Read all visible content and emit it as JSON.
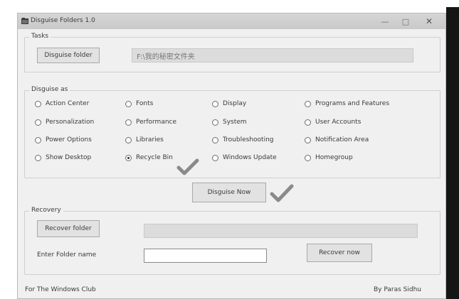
{
  "window": {
    "title": "Disguise Folders 1.0",
    "minimize": "—",
    "maximize": "□",
    "close": "✕"
  },
  "tasks": {
    "legend": "Tasks",
    "disguise_button": "Disguise folder",
    "path": "F:\\我的秘密文件夹"
  },
  "disguise_as": {
    "legend": "Disguise as",
    "options": [
      {
        "label": "Action Center",
        "checked": false
      },
      {
        "label": "Fonts",
        "checked": false
      },
      {
        "label": "Display",
        "checked": false
      },
      {
        "label": "Programs and Features",
        "checked": false
      },
      {
        "label": "Personalization",
        "checked": false
      },
      {
        "label": "Performance",
        "checked": false
      },
      {
        "label": "System",
        "checked": false
      },
      {
        "label": "User Accounts",
        "checked": false
      },
      {
        "label": "Power Options",
        "checked": false
      },
      {
        "label": "Libraries",
        "checked": false
      },
      {
        "label": "Troubleshooting",
        "checked": false
      },
      {
        "label": "Notification Area",
        "checked": false
      },
      {
        "label": "Show Desktop",
        "checked": false
      },
      {
        "label": "Recycle Bin",
        "checked": true
      },
      {
        "label": "Windows Update",
        "checked": false
      },
      {
        "label": "Homegroup",
        "checked": false
      }
    ]
  },
  "disguise_now_button": "Disguise Now",
  "recovery": {
    "legend": "Recovery",
    "recover_button": "Recover folder",
    "recover_path": "",
    "name_label": "Enter Folder name",
    "name_value": "",
    "recover_now_button": "Recover now"
  },
  "footer": {
    "left": "For The Windows Club",
    "right": "By Paras Sidhu"
  },
  "colors": {
    "checkmark": "#8a8a8a",
    "window_bg": "#f0f0f0",
    "titlebar": "#cfcfcf"
  }
}
